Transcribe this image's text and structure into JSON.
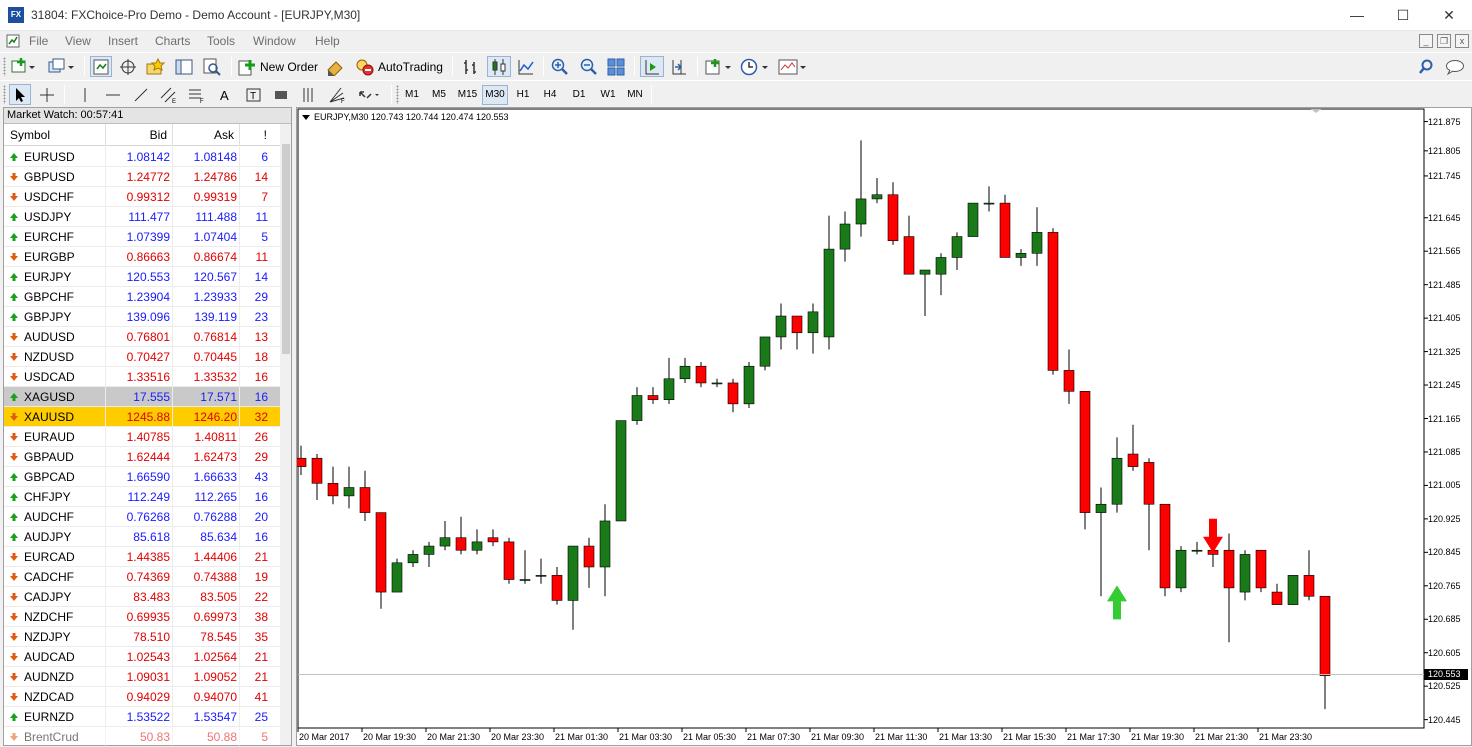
{
  "window": {
    "title": "31804: FXChoice-Pro Demo - Demo Account - [EURJPY,M30]",
    "logo_text": "FX",
    "controls": {
      "minimize": "—",
      "maximize": "☐",
      "close": "✕"
    }
  },
  "menu": {
    "items": [
      "File",
      "View",
      "Insert",
      "Charts",
      "Tools",
      "Window",
      "Help"
    ]
  },
  "toolbar": {
    "new_order_label": "New Order",
    "autotrading_label": "AutoTrading"
  },
  "timeframes": [
    "M1",
    "M5",
    "M15",
    "M30",
    "H1",
    "H4",
    "D1",
    "W1",
    "MN"
  ],
  "active_timeframe": "M30",
  "market_watch": {
    "title": "Market Watch: 00:57:41",
    "columns": {
      "symbol": "Symbol",
      "bid": "Bid",
      "ask": "Ask",
      "spread": "!"
    },
    "colors": {
      "up": "#1919ff",
      "down": "#e00000",
      "up_arrow": "#1aa01a",
      "down_arrow": "#e05a10",
      "highlight_gold": "#ffcc00",
      "highlight_grey": "#c9c9c9"
    },
    "rows": [
      {
        "symbol": "EURUSD",
        "bid": "1.08142",
        "ask": "1.08148",
        "spread": "6",
        "dir": "up"
      },
      {
        "symbol": "GBPUSD",
        "bid": "1.24772",
        "ask": "1.24786",
        "spread": "14",
        "dir": "down"
      },
      {
        "symbol": "USDCHF",
        "bid": "0.99312",
        "ask": "0.99319",
        "spread": "7",
        "dir": "down"
      },
      {
        "symbol": "USDJPY",
        "bid": "111.477",
        "ask": "111.488",
        "spread": "11",
        "dir": "up"
      },
      {
        "symbol": "EURCHF",
        "bid": "1.07399",
        "ask": "1.07404",
        "spread": "5",
        "dir": "up"
      },
      {
        "symbol": "EURGBP",
        "bid": "0.86663",
        "ask": "0.86674",
        "spread": "11",
        "dir": "down"
      },
      {
        "symbol": "EURJPY",
        "bid": "120.553",
        "ask": "120.567",
        "spread": "14",
        "dir": "up"
      },
      {
        "symbol": "GBPCHF",
        "bid": "1.23904",
        "ask": "1.23933",
        "spread": "29",
        "dir": "up"
      },
      {
        "symbol": "GBPJPY",
        "bid": "139.096",
        "ask": "139.119",
        "spread": "23",
        "dir": "up"
      },
      {
        "symbol": "AUDUSD",
        "bid": "0.76801",
        "ask": "0.76814",
        "spread": "13",
        "dir": "down"
      },
      {
        "symbol": "NZDUSD",
        "bid": "0.70427",
        "ask": "0.70445",
        "spread": "18",
        "dir": "down"
      },
      {
        "symbol": "USDCAD",
        "bid": "1.33516",
        "ask": "1.33532",
        "spread": "16",
        "dir": "down"
      },
      {
        "symbol": "XAGUSD",
        "bid": "17.555",
        "ask": "17.571",
        "spread": "16",
        "dir": "up",
        "highlight": "grey"
      },
      {
        "symbol": "XAUUSD",
        "bid": "1245.88",
        "ask": "1246.20",
        "spread": "32",
        "dir": "down",
        "highlight": "gold"
      },
      {
        "symbol": "EURAUD",
        "bid": "1.40785",
        "ask": "1.40811",
        "spread": "26",
        "dir": "down"
      },
      {
        "symbol": "GBPAUD",
        "bid": "1.62444",
        "ask": "1.62473",
        "spread": "29",
        "dir": "down"
      },
      {
        "symbol": "GBPCAD",
        "bid": "1.66590",
        "ask": "1.66633",
        "spread": "43",
        "dir": "up"
      },
      {
        "symbol": "CHFJPY",
        "bid": "112.249",
        "ask": "112.265",
        "spread": "16",
        "dir": "up"
      },
      {
        "symbol": "AUDCHF",
        "bid": "0.76268",
        "ask": "0.76288",
        "spread": "20",
        "dir": "up"
      },
      {
        "symbol": "AUDJPY",
        "bid": "85.618",
        "ask": "85.634",
        "spread": "16",
        "dir": "up"
      },
      {
        "symbol": "EURCAD",
        "bid": "1.44385",
        "ask": "1.44406",
        "spread": "21",
        "dir": "down"
      },
      {
        "symbol": "CADCHF",
        "bid": "0.74369",
        "ask": "0.74388",
        "spread": "19",
        "dir": "down"
      },
      {
        "symbol": "CADJPY",
        "bid": "83.483",
        "ask": "83.505",
        "spread": "22",
        "dir": "down"
      },
      {
        "symbol": "NZDCHF",
        "bid": "0.69935",
        "ask": "0.69973",
        "spread": "38",
        "dir": "down"
      },
      {
        "symbol": "NZDJPY",
        "bid": "78.510",
        "ask": "78.545",
        "spread": "35",
        "dir": "down"
      },
      {
        "symbol": "AUDCAD",
        "bid": "1.02543",
        "ask": "1.02564",
        "spread": "21",
        "dir": "down"
      },
      {
        "symbol": "AUDNZD",
        "bid": "1.09031",
        "ask": "1.09052",
        "spread": "21",
        "dir": "down"
      },
      {
        "symbol": "NZDCAD",
        "bid": "0.94029",
        "ask": "0.94070",
        "spread": "41",
        "dir": "down"
      },
      {
        "symbol": "EURNZD",
        "bid": "1.53522",
        "ask": "1.53547",
        "spread": "25",
        "dir": "up"
      },
      {
        "symbol": "BrentCrud",
        "bid": "50.83",
        "ask": "50.88",
        "spread": "5",
        "dir": "down"
      }
    ]
  },
  "chart": {
    "info": "EURJPY,M30  120.743 120.744 120.474 120.553",
    "current_price": "120.553",
    "colors": {
      "bull": "#1a7a1a",
      "bear": "#ff0000",
      "up_marker": "#33cc33",
      "down_marker": "#ff0000",
      "grid_line": "#c0c0c0"
    }
  },
  "chart_data": {
    "type": "candlestick",
    "symbol": "EURJPY",
    "timeframe": "M30",
    "ylim": [
      120.44,
      121.88
    ],
    "y_ticks": [
      "121.875",
      "121.805",
      "121.745",
      "121.645",
      "121.565",
      "121.485",
      "121.405",
      "121.325",
      "121.245",
      "121.165",
      "121.085",
      "121.005",
      "120.925",
      "120.845",
      "120.765",
      "120.685",
      "120.605",
      "120.525",
      "120.445"
    ],
    "x_labels": [
      "20 Mar 2017",
      "20 Mar 19:30",
      "20 Mar 21:30",
      "20 Mar 23:30",
      "21 Mar 01:30",
      "21 Mar 03:30",
      "21 Mar 05:30",
      "21 Mar 07:30",
      "21 Mar 09:30",
      "21 Mar 11:30",
      "21 Mar 13:30",
      "21 Mar 15:30",
      "21 Mar 17:30",
      "21 Mar 19:30",
      "21 Mar 21:30",
      "21 Mar 23:30"
    ],
    "candles": [
      {
        "o": 121.07,
        "h": 121.1,
        "l": 121.03,
        "c": 121.05
      },
      {
        "o": 121.07,
        "h": 121.08,
        "l": 120.97,
        "c": 121.01
      },
      {
        "o": 121.01,
        "h": 121.05,
        "l": 120.96,
        "c": 120.98
      },
      {
        "o": 120.98,
        "h": 121.05,
        "l": 120.95,
        "c": 121.0
      },
      {
        "o": 121.0,
        "h": 121.04,
        "l": 120.92,
        "c": 120.94
      },
      {
        "o": 120.94,
        "h": 120.94,
        "l": 120.71,
        "c": 120.75
      },
      {
        "o": 120.75,
        "h": 120.83,
        "l": 120.75,
        "c": 120.82
      },
      {
        "o": 120.82,
        "h": 120.85,
        "l": 120.81,
        "c": 120.84
      },
      {
        "o": 120.84,
        "h": 120.87,
        "l": 120.81,
        "c": 120.86
      },
      {
        "o": 120.86,
        "h": 120.92,
        "l": 120.85,
        "c": 120.88
      },
      {
        "o": 120.88,
        "h": 120.93,
        "l": 120.84,
        "c": 120.85
      },
      {
        "o": 120.85,
        "h": 120.9,
        "l": 120.84,
        "c": 120.87
      },
      {
        "o": 120.88,
        "h": 120.9,
        "l": 120.86,
        "c": 120.87
      },
      {
        "o": 120.87,
        "h": 120.88,
        "l": 120.77,
        "c": 120.78
      },
      {
        "o": 120.78,
        "h": 120.85,
        "l": 120.77,
        "c": 120.78
      },
      {
        "o": 120.79,
        "h": 120.83,
        "l": 120.77,
        "c": 120.79
      },
      {
        "o": 120.79,
        "h": 120.81,
        "l": 120.72,
        "c": 120.73
      },
      {
        "o": 120.73,
        "h": 120.86,
        "l": 120.66,
        "c": 120.86
      },
      {
        "o": 120.86,
        "h": 120.88,
        "l": 120.76,
        "c": 120.81
      },
      {
        "o": 120.81,
        "h": 120.96,
        "l": 120.74,
        "c": 120.92
      },
      {
        "o": 120.92,
        "h": 121.16,
        "l": 120.92,
        "c": 121.16
      },
      {
        "o": 121.16,
        "h": 121.24,
        "l": 121.15,
        "c": 121.22
      },
      {
        "o": 121.22,
        "h": 121.24,
        "l": 121.2,
        "c": 121.21
      },
      {
        "o": 121.21,
        "h": 121.31,
        "l": 121.2,
        "c": 121.26
      },
      {
        "o": 121.26,
        "h": 121.31,
        "l": 121.25,
        "c": 121.29
      },
      {
        "o": 121.29,
        "h": 121.3,
        "l": 121.24,
        "c": 121.25
      },
      {
        "o": 121.25,
        "h": 121.26,
        "l": 121.24,
        "c": 121.25
      },
      {
        "o": 121.25,
        "h": 121.26,
        "l": 121.18,
        "c": 121.2
      },
      {
        "o": 121.2,
        "h": 121.3,
        "l": 121.19,
        "c": 121.29
      },
      {
        "o": 121.29,
        "h": 121.36,
        "l": 121.28,
        "c": 121.36
      },
      {
        "o": 121.36,
        "h": 121.44,
        "l": 121.33,
        "c": 121.41
      },
      {
        "o": 121.41,
        "h": 121.41,
        "l": 121.33,
        "c": 121.37
      },
      {
        "o": 121.37,
        "h": 121.44,
        "l": 121.32,
        "c": 121.42
      },
      {
        "o": 121.36,
        "h": 121.65,
        "l": 121.33,
        "c": 121.57
      },
      {
        "o": 121.57,
        "h": 121.66,
        "l": 121.54,
        "c": 121.63
      },
      {
        "o": 121.63,
        "h": 121.83,
        "l": 121.6,
        "c": 121.69
      },
      {
        "o": 121.69,
        "h": 121.74,
        "l": 121.68,
        "c": 121.7
      },
      {
        "o": 121.7,
        "h": 121.73,
        "l": 121.58,
        "c": 121.59
      },
      {
        "o": 121.6,
        "h": 121.65,
        "l": 121.51,
        "c": 121.51
      },
      {
        "o": 121.51,
        "h": 121.52,
        "l": 121.41,
        "c": 121.52
      },
      {
        "o": 121.51,
        "h": 121.56,
        "l": 121.46,
        "c": 121.55
      },
      {
        "o": 121.55,
        "h": 121.61,
        "l": 121.52,
        "c": 121.6
      },
      {
        "o": 121.6,
        "h": 121.68,
        "l": 121.6,
        "c": 121.68
      },
      {
        "o": 121.68,
        "h": 121.72,
        "l": 121.66,
        "c": 121.68
      },
      {
        "o": 121.68,
        "h": 121.7,
        "l": 121.55,
        "c": 121.55
      },
      {
        "o": 121.55,
        "h": 121.57,
        "l": 121.53,
        "c": 121.56
      },
      {
        "o": 121.56,
        "h": 121.67,
        "l": 121.53,
        "c": 121.61
      },
      {
        "o": 121.61,
        "h": 121.62,
        "l": 121.27,
        "c": 121.28
      },
      {
        "o": 121.28,
        "h": 121.33,
        "l": 121.2,
        "c": 121.23
      },
      {
        "o": 121.23,
        "h": 121.23,
        "l": 120.9,
        "c": 120.94
      },
      {
        "o": 120.94,
        "h": 121.0,
        "l": 120.74,
        "c": 120.96
      },
      {
        "o": 120.96,
        "h": 121.12,
        "l": 120.94,
        "c": 121.07
      },
      {
        "o": 121.08,
        "h": 121.15,
        "l": 121.04,
        "c": 121.05
      },
      {
        "o": 121.06,
        "h": 121.07,
        "l": 120.85,
        "c": 120.96
      },
      {
        "o": 120.96,
        "h": 120.96,
        "l": 120.74,
        "c": 120.76
      },
      {
        "o": 120.76,
        "h": 120.86,
        "l": 120.75,
        "c": 120.85
      },
      {
        "o": 120.85,
        "h": 120.87,
        "l": 120.84,
        "c": 120.85
      },
      {
        "o": 120.85,
        "h": 120.92,
        "l": 120.81,
        "c": 120.84
      },
      {
        "o": 120.85,
        "h": 120.89,
        "l": 120.63,
        "c": 120.76
      },
      {
        "o": 120.75,
        "h": 120.85,
        "l": 120.73,
        "c": 120.84
      },
      {
        "o": 120.85,
        "h": 120.85,
        "l": 120.75,
        "c": 120.76
      },
      {
        "o": 120.75,
        "h": 120.77,
        "l": 120.72,
        "c": 120.72
      },
      {
        "o": 120.72,
        "h": 120.79,
        "l": 120.72,
        "c": 120.79
      },
      {
        "o": 120.79,
        "h": 120.85,
        "l": 120.73,
        "c": 120.74
      },
      {
        "o": 120.74,
        "h": 120.74,
        "l": 120.47,
        "c": 120.55
      }
    ],
    "markers": [
      {
        "type": "up-arrow",
        "candle": 51,
        "price": 120.68
      },
      {
        "type": "down-arrow",
        "candle": 57,
        "price": 120.93
      }
    ],
    "current_price_line": 120.553
  }
}
